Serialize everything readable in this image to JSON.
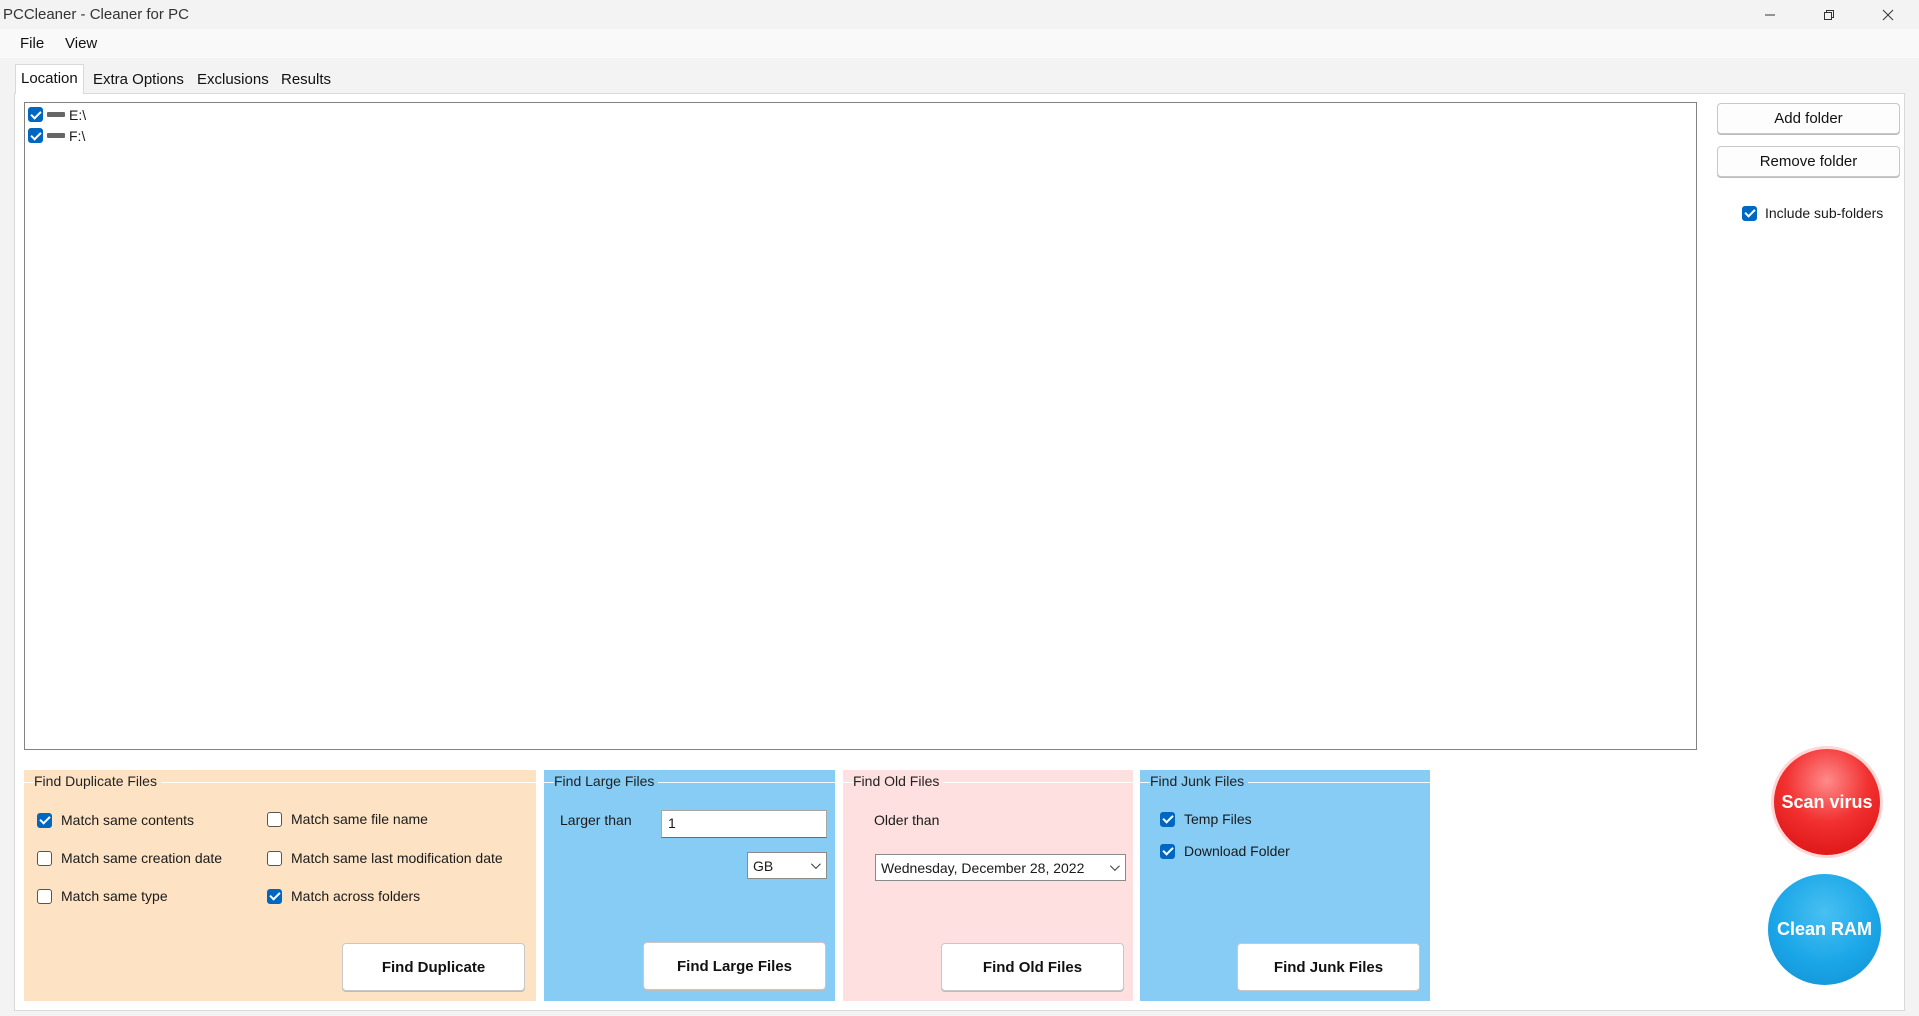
{
  "window": {
    "title": "PCCleaner - Cleaner for PC",
    "controls": [
      "minimize-icon",
      "restore-icon",
      "close-icon"
    ]
  },
  "menu": {
    "file": "File",
    "view": "View"
  },
  "tabs": [
    {
      "label": "Location",
      "active": true
    },
    {
      "label": "Extra Options",
      "active": false
    },
    {
      "label": "Exclusions",
      "active": false
    },
    {
      "label": "Results",
      "active": false
    }
  ],
  "locations": [
    {
      "path": "E:\\",
      "checked": true
    },
    {
      "path": "F:\\",
      "checked": true
    }
  ],
  "sidebar": {
    "add_folder": "Add folder",
    "remove_folder": "Remove folder",
    "include_subfolders": {
      "label": "Include sub-folders",
      "checked": true
    }
  },
  "duplicate": {
    "title": "Find Duplicate Files",
    "options": {
      "same_contents": {
        "label": "Match same contents",
        "checked": true
      },
      "same_creation_date": {
        "label": "Match same creation date",
        "checked": false
      },
      "same_type": {
        "label": "Match same type",
        "checked": false
      },
      "same_file_name": {
        "label": "Match same file name",
        "checked": false
      },
      "same_mod_date": {
        "label": "Match same last modification date",
        "checked": false
      },
      "across_folders": {
        "label": "Match across folders",
        "checked": true
      }
    },
    "button": "Find Duplicate"
  },
  "large": {
    "title": "Find Large Files",
    "label": "Larger than",
    "value": "1",
    "unit": "GB",
    "button": "Find Large Files"
  },
  "old": {
    "title": "Find Old Files",
    "label": "Older than",
    "date": "Wednesday,  December  28, 2022",
    "button": "Find Old Files"
  },
  "junk": {
    "title": "Find Junk Files",
    "options": {
      "temp": {
        "label": "Temp Files",
        "checked": true
      },
      "download": {
        "label": "Download Folder",
        "checked": true
      }
    },
    "button": "Find Junk Files"
  },
  "actions": {
    "scan_virus": "Scan virus",
    "clean_ram": "Clean RAM"
  },
  "colors": {
    "duplicate_panel": "#fde3c4",
    "large_panel": "#86ccf5",
    "old_panel": "#fde0df",
    "junk_panel": "#86ccf5",
    "scan_virus": "#f23131",
    "clean_ram": "#1aa6e8",
    "checkbox_accent": "#0067c0"
  }
}
